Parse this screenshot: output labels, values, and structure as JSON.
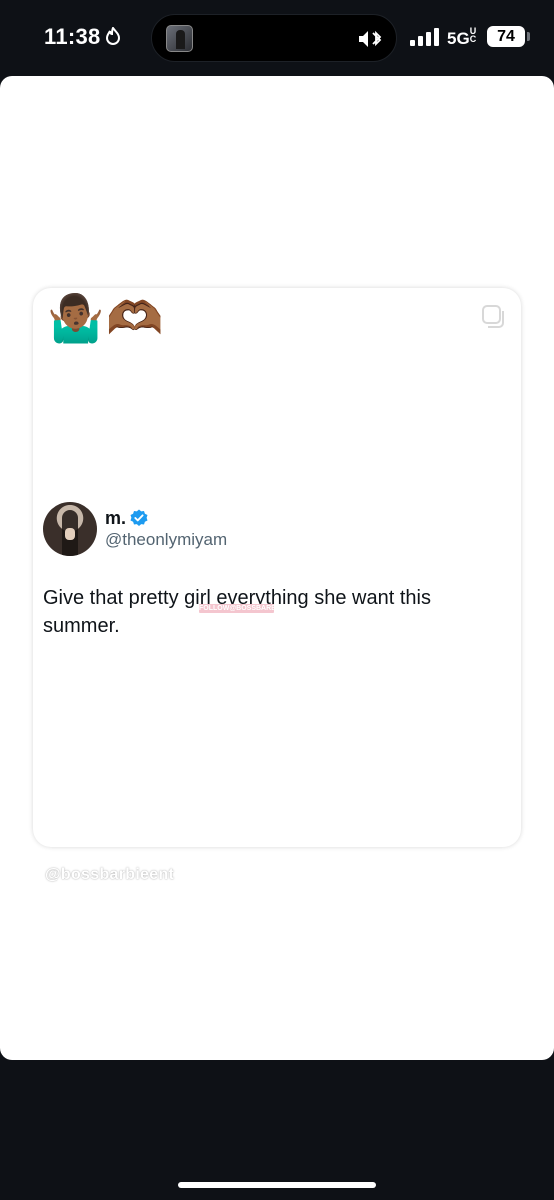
{
  "status_bar": {
    "time": "11:38",
    "network": "5G",
    "network_suffix": "UC",
    "battery": "74",
    "icons": [
      "flame-icon",
      "mute-icon",
      "bluetooth-icon",
      "signal-icon",
      "battery-icon"
    ]
  },
  "post": {
    "emojis": "🤷🏾‍♂️🫶🏾",
    "tweet": {
      "display_name": "m.",
      "handle": "@theonlymiyam",
      "verified": true,
      "text": "Give that pretty girl everything she want this summer.",
      "inline_watermark": "FOLLOW@BOSSBARBIEENT"
    },
    "watermark": "@bossbarbieent"
  },
  "colors": {
    "background": "#0e1116",
    "sheet": "#ffffff",
    "verified": "#1d9bf0",
    "handle": "#536471",
    "text": "#0f1419"
  }
}
